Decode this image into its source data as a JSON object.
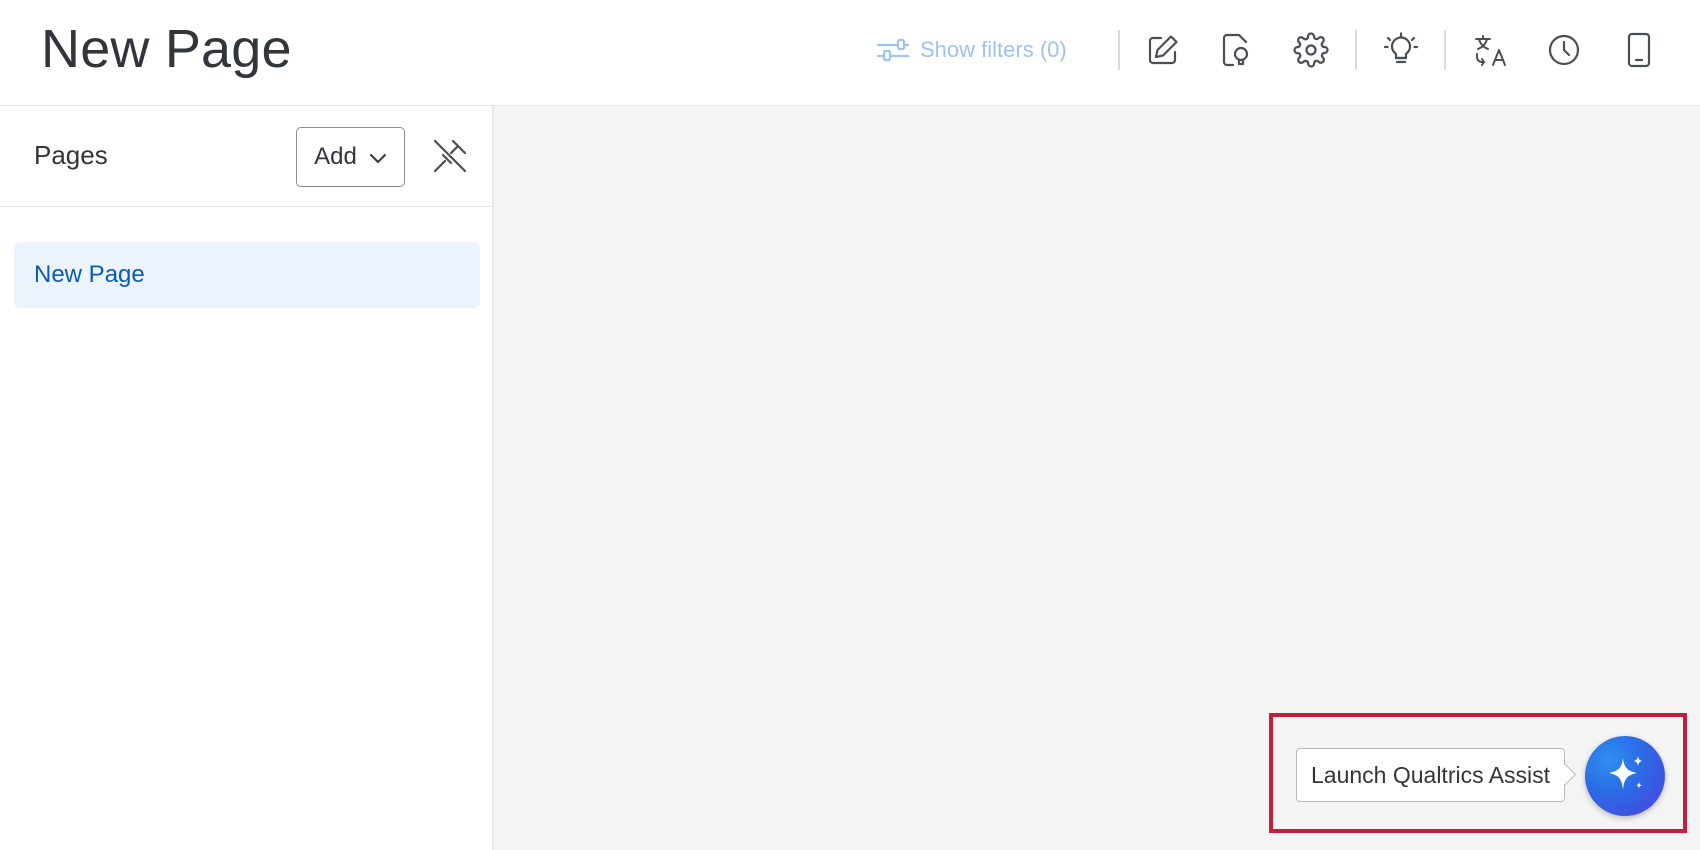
{
  "header": {
    "title": "New Page",
    "filters_label": "Show filters (0)",
    "tools": [
      {
        "icon": "edit-icon"
      },
      {
        "icon": "insights-icon"
      },
      {
        "icon": "gear-icon"
      },
      {
        "icon": "lightbulb-icon"
      },
      {
        "icon": "translate-icon"
      },
      {
        "icon": "clock-icon"
      },
      {
        "icon": "mobile-icon"
      }
    ]
  },
  "sidebar": {
    "title": "Pages",
    "add_label": "Add",
    "unpin_icon": "unpin-icon",
    "items": [
      {
        "label": "New Page",
        "selected": true
      }
    ]
  },
  "assist": {
    "tooltip": "Launch Qualtrics Assist",
    "icon": "sparkle-icon"
  },
  "colors": {
    "accent": "#0b5bb5",
    "selected_bg": "#ebf3fc",
    "filters_text": "#9ec3ec",
    "highlight_frame": "#c41e3a",
    "canvas_bg": "#f4f4f4"
  }
}
